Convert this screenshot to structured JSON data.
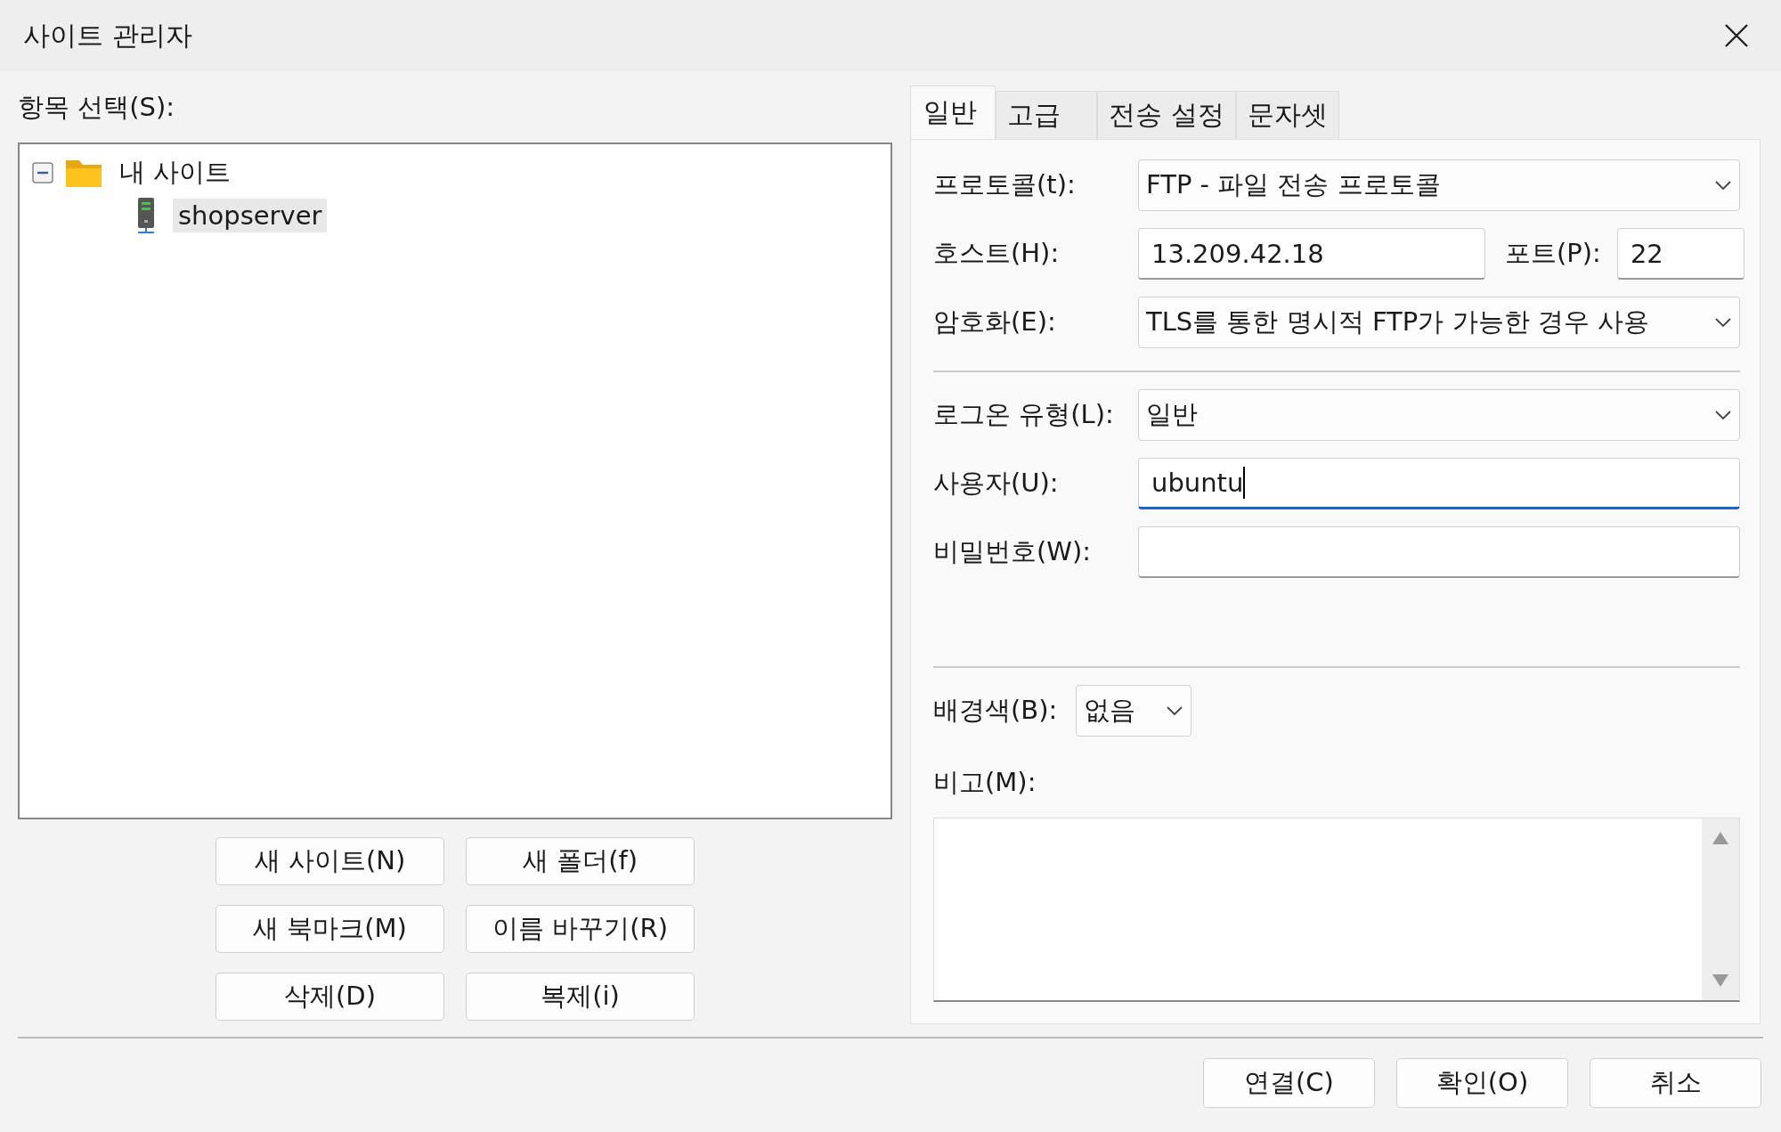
{
  "window": {
    "title": "사이트 관리자"
  },
  "site_list": {
    "label": "항목 선택(S):",
    "tree": [
      {
        "label": "내 사이트",
        "kind": "folder",
        "expanded": true,
        "selected": false,
        "children": [
          {
            "label": "shopserver",
            "kind": "server",
            "selected": true
          }
        ]
      }
    ]
  },
  "site_buttons": [
    {
      "label": "새 사이트(N)"
    },
    {
      "label": "새 폴더(f)"
    },
    {
      "label": "새 북마크(M)"
    },
    {
      "label": "이름 바꾸기(R)"
    },
    {
      "label": "삭제(D)"
    },
    {
      "label": "복제(i)"
    }
  ],
  "tabs": [
    {
      "label": "일반",
      "selected": true
    },
    {
      "label": "고급",
      "selected": false
    },
    {
      "label": "전송 설정",
      "selected": false
    },
    {
      "label": "문자셋",
      "selected": false
    }
  ],
  "connection": [
    {
      "kind": "select",
      "label": "프로토콜(t):",
      "value": "FTP - 파일 전송 프로토콜"
    },
    {
      "kind": "host",
      "label": "호스트(H):",
      "value": "13.209.42.18",
      "port_label": "포트(P):",
      "port": "22"
    },
    {
      "kind": "select",
      "label": "암호화(E):",
      "value": "TLS를 통한 명시적 FTP가 가능한 경우 사용"
    }
  ],
  "login": [
    {
      "kind": "select",
      "label": "로그온 유형(L):",
      "value": "일반",
      "focused": false
    },
    {
      "kind": "input",
      "label": "사용자(U):",
      "value": "ubuntu",
      "focused": true
    },
    {
      "kind": "input",
      "label": "비밀번호(W):",
      "focused": false
    }
  ],
  "background_color": {
    "label": "배경색(B):",
    "value": "없음"
  },
  "comments": {
    "label": "비고(M):"
  },
  "dialog_buttons": [
    {
      "label": "연결(C)"
    },
    {
      "label": "확인(O)"
    },
    {
      "label": "취소"
    }
  ]
}
